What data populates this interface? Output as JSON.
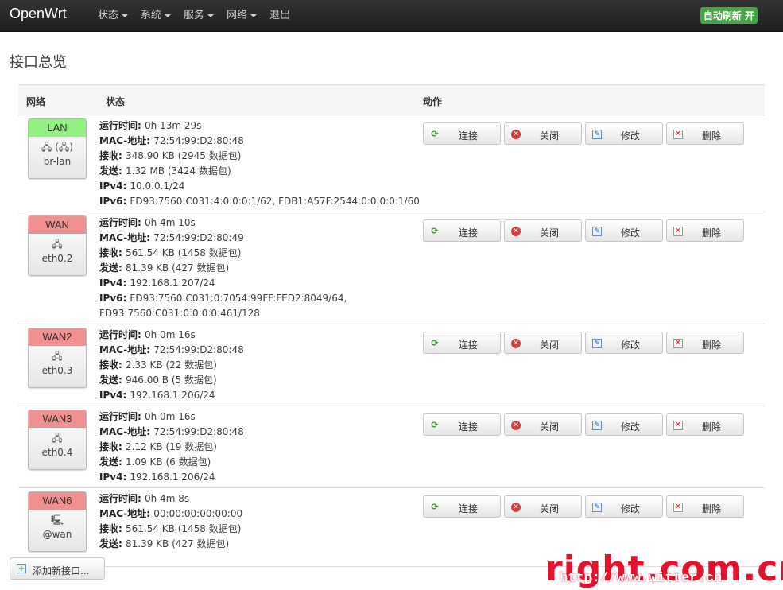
{
  "brand": "OpenWrt",
  "menu": [
    {
      "label": "状态",
      "dropdown": true
    },
    {
      "label": "系统",
      "dropdown": true
    },
    {
      "label": "服务",
      "dropdown": true
    },
    {
      "label": "网络",
      "dropdown": true
    },
    {
      "label": "退出",
      "dropdown": false
    }
  ],
  "autorefresh": "自动刷新 开",
  "page_title": "接口总览",
  "table": {
    "headers": {
      "network": "网络",
      "status": "状态",
      "actions": "动作"
    }
  },
  "labels": {
    "uptime": "运行时间",
    "mac": "MAC-地址",
    "rx": "接收",
    "tx": "发送",
    "ipv4": "IPv4",
    "ipv6": "IPv6"
  },
  "buttons": {
    "connect": "连接",
    "shutdown": "关闭",
    "edit": "修改",
    "delete": "删除"
  },
  "interfaces": [
    {
      "name": "LAN",
      "device": "br-lan",
      "type": "lan",
      "icons": "🖧 (🖧)",
      "uptime": "0h 13m 29s",
      "mac": "72:54:99:D2:80:48",
      "rx": "348.90 KB (2945 数据包)",
      "tx": "1.32 MB (3424 数据包)",
      "ipv4": "10.0.0.1/24",
      "ipv6": "FD93:7560:C031:4:0:0:0:1/62, FDB1:A57F:2544:0:0:0:0:1/60",
      "ipv6_cont": ""
    },
    {
      "name": "WAN",
      "device": "eth0.2",
      "type": "wan",
      "icons": "🖧",
      "uptime": "0h 4m 10s",
      "mac": "72:54:99:D2:80:49",
      "rx": "561.54 KB (1458 数据包)",
      "tx": "81.39 KB (427 数据包)",
      "ipv4": "192.168.1.207/24",
      "ipv6": "FD93:7560:C031:0:7054:99FF:FED2:8049/64,",
      "ipv6_cont": "FD93:7560:C031:0:0:0:0:461/128"
    },
    {
      "name": "WAN2",
      "device": "eth0.3",
      "type": "wan",
      "icons": "🖧",
      "uptime": "0h 0m 16s",
      "mac": "72:54:99:D2:80:48",
      "rx": "2.33 KB (22 数据包)",
      "tx": "946.00 B (5 数据包)",
      "ipv4": "192.168.1.206/24",
      "ipv6": "",
      "ipv6_cont": ""
    },
    {
      "name": "WAN3",
      "device": "eth0.4",
      "type": "wan",
      "icons": "🖧",
      "uptime": "0h 0m 16s",
      "mac": "72:54:99:D2:80:48",
      "rx": "2.12 KB (19 数据包)",
      "tx": "1.09 KB (6 数据包)",
      "ipv4": "192.168.1.206/24",
      "ipv6": "",
      "ipv6_cont": ""
    },
    {
      "name": "WAN6",
      "device": "@wan",
      "type": "wan",
      "icons": "🖳",
      "uptime": "0h 4m 8s",
      "mac": "00:00:00:00:00:00",
      "rx": "561.54 KB (1458 数据包)",
      "tx": "81.39 KB (427 数据包)",
      "ipv4": "",
      "ipv6": "",
      "ipv6_cont": ""
    }
  ],
  "add_button": "添加新接口...",
  "watermark": "right.com.cn",
  "watermark_sub": "http://www.witter.cn"
}
